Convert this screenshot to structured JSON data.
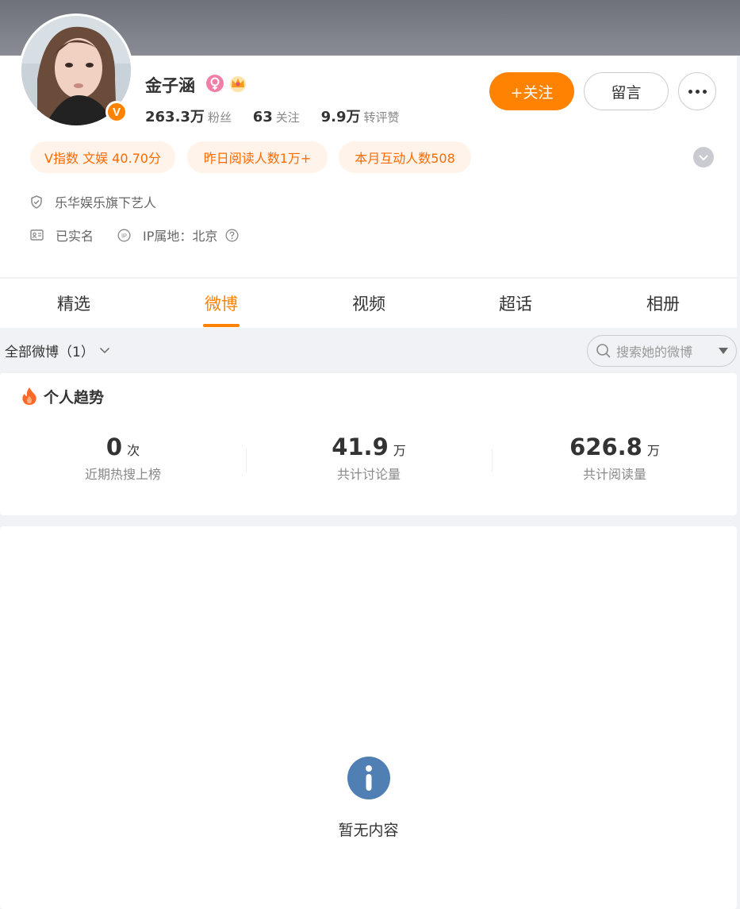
{
  "profile": {
    "name": "金子涵",
    "verified_badge": "V",
    "stats": [
      {
        "value": "263.3万",
        "label": "粉丝"
      },
      {
        "value": "63",
        "label": "关注"
      },
      {
        "value": "9.9万",
        "label": "转评赞"
      }
    ],
    "actions": {
      "follow": "+关注",
      "message": "留言"
    },
    "tags": [
      "V指数 文娱 40.70分",
      "昨日阅读人数1万+",
      "本月互动人数508"
    ],
    "company": "乐华娱乐旗下艺人",
    "real_name": "已实名",
    "ip_location": "IP属地：北京"
  },
  "tabs": [
    {
      "label": "精选",
      "active": false
    },
    {
      "label": "微博",
      "active": true
    },
    {
      "label": "视频",
      "active": false
    },
    {
      "label": "超话",
      "active": false
    },
    {
      "label": "相册",
      "active": false
    }
  ],
  "filter": {
    "label": "全部微博（1）"
  },
  "search": {
    "placeholder": "搜索她的微博"
  },
  "trends": {
    "title": "个人趋势",
    "items": [
      {
        "value": "0",
        "unit": "次",
        "label": "近期热搜上榜"
      },
      {
        "value": "41.9",
        "unit": "万",
        "label": "共计讨论量"
      },
      {
        "value": "626.8",
        "unit": "万",
        "label": "共计阅读量"
      }
    ]
  },
  "empty": {
    "text": "暂无内容"
  },
  "colors": {
    "accent": "#ff8200",
    "tag_bg": "#fff3ea",
    "tag_text": "#ff6a00",
    "info_icon": "#4f7fb3",
    "page_bg": "#f1f2f5"
  },
  "icons": [
    "verified-icon",
    "female-icon",
    "crown-icon",
    "more-icon",
    "chevron-down-icon",
    "shield-icon",
    "id-card-icon",
    "ip-icon",
    "help-icon",
    "search-icon",
    "dropdown-triangle-icon",
    "fire-icon",
    "info-icon"
  ]
}
